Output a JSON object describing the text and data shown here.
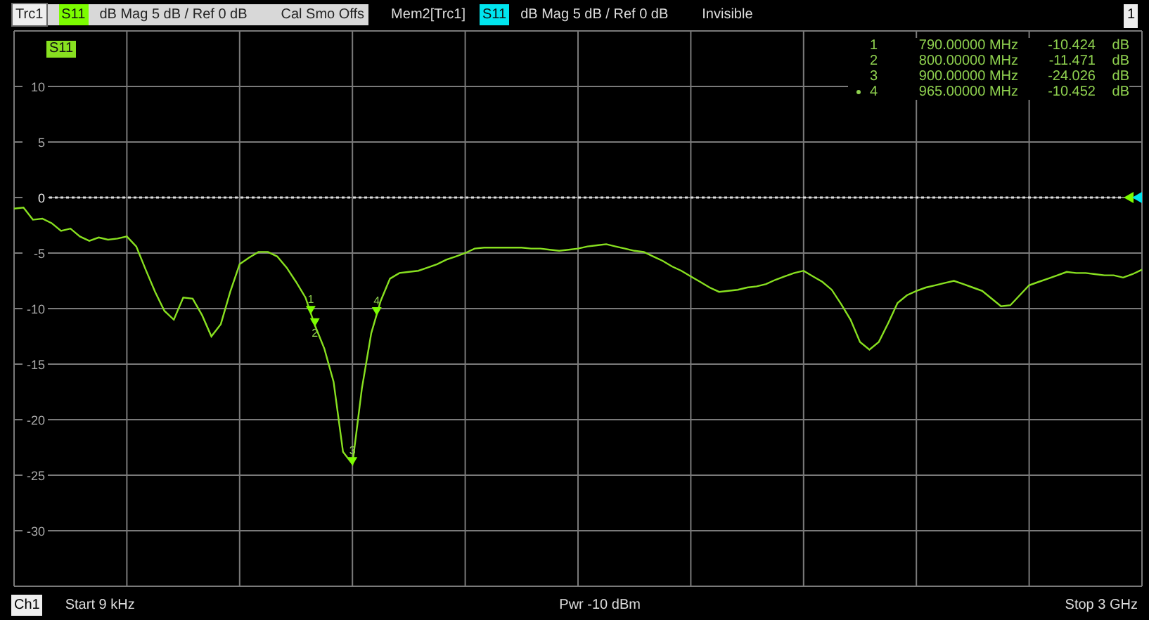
{
  "header": {
    "traces": [
      {
        "name": "Trc1",
        "parameter": "S11",
        "color": "#7cfc00",
        "format": "dB Mag 5 dB / Ref 0 dB",
        "flags": "Cal Smo Offs",
        "highlighted": true
      },
      {
        "name": "Mem2[Trc1]",
        "parameter": "S11",
        "color": "#00e5ee",
        "format": "dB Mag 5 dB / Ref 0 dB",
        "flags": "Invisible",
        "highlighted": false
      }
    ],
    "window_number": "1"
  },
  "diagram": {
    "marker_table": [
      {
        "number": "1",
        "frequency": "790.00000 MHz",
        "value": "-10.424",
        "unit": "dB",
        "active": false
      },
      {
        "number": "2",
        "frequency": "800.00000 MHz",
        "value": "-11.471",
        "unit": "dB",
        "active": false
      },
      {
        "number": "3",
        "frequency": "900.00000 MHz",
        "value": "-24.026",
        "unit": "dB",
        "active": false
      },
      {
        "number": "4",
        "frequency": "965.00000 MHz",
        "value": "-10.452",
        "unit": "dB",
        "active": true
      }
    ],
    "chart_data": {
      "type": "line",
      "grid": true,
      "ref_lines": [
        {
          "axis": "y",
          "value": 0
        }
      ],
      "ylim": [
        -35,
        15
      ],
      "yticks": [
        10,
        5,
        0,
        -5,
        -10,
        -15,
        -20,
        -25,
        -30
      ],
      "categories": [
        null,
        null,
        null,
        null,
        null,
        null,
        null,
        null,
        null,
        null,
        null,
        null,
        null,
        null,
        null,
        null,
        null,
        null,
        null,
        null,
        null,
        null,
        null,
        null,
        null,
        null,
        null,
        null,
        null,
        null,
        null,
        null,
        null,
        null,
        null,
        null,
        null,
        null,
        null,
        null,
        null,
        null,
        null,
        null,
        null,
        null,
        null,
        null,
        null,
        null,
        null,
        null,
        null,
        null,
        null,
        null,
        null,
        null,
        null,
        null,
        null,
        null,
        null,
        null,
        null,
        null,
        null,
        null,
        null,
        null,
        null,
        null,
        null,
        null,
        null,
        null,
        null,
        null,
        null,
        null,
        null,
        null,
        null,
        null,
        null,
        null,
        null,
        null,
        null,
        null,
        null,
        null,
        null,
        null,
        null,
        null,
        null,
        null,
        null,
        null,
        null,
        null,
        null,
        null,
        null,
        null,
        null,
        null,
        null,
        null,
        null,
        null,
        null,
        null,
        null,
        null,
        null,
        null,
        null,
        null,
        null
      ],
      "series": [
        {
          "name": "S11",
          "color": "#88e020",
          "values": [
            -1,
            -0.9,
            -2,
            -1.9,
            -2.3,
            -3,
            -2.8,
            -3.5,
            -3.9,
            -3.6,
            -3.8,
            -3.7,
            -3.5,
            -4.4,
            -6.5,
            -8.5,
            -10.2,
            -11,
            -9,
            -9.1,
            -10.6,
            -12.5,
            -11.4,
            -8.5,
            -6,
            -5.4,
            -4.9,
            -4.9,
            -5.3,
            -6.3,
            -7.6,
            -9,
            -11.5,
            -13.6,
            -16.6,
            -22.9,
            -24,
            -17.2,
            -12.2,
            -9.3,
            -7.3,
            -6.8,
            -6.7,
            -6.6,
            -6.3,
            -6,
            -5.6,
            -5.3,
            -5,
            -4.6,
            -4.5,
            -4.5,
            -4.5,
            -4.5,
            -4.5,
            -4.6,
            -4.6,
            -4.7,
            -4.8,
            -4.7,
            -4.6,
            -4.4,
            -4.3,
            -4.2,
            -4.4,
            -4.6,
            -4.8,
            -4.9,
            -5.3,
            -5.7,
            -6.2,
            -6.6,
            -7.1,
            -7.6,
            -8.1,
            -8.5,
            -8.4,
            -8.3,
            -8.1,
            -8,
            -7.8,
            -7.4,
            -7.1,
            -6.8,
            -6.6,
            -7.1,
            -7.6,
            -8.3,
            -9.6,
            -11,
            -13,
            -13.7,
            -13,
            -11.3,
            -9.5,
            -8.8,
            -8.4,
            -8.1,
            -7.9,
            -7.7,
            -7.5,
            -7.8,
            -8.1,
            -8.4,
            -9.1,
            -9.8,
            -9.7,
            -8.8,
            -7.9,
            -7.6,
            -7.3,
            -7,
            -6.7,
            -6.8,
            -6.8,
            -6.9,
            -7,
            -7,
            -7.2,
            -6.9,
            -6.5
          ]
        }
      ],
      "annotations": [
        {
          "text": "1",
          "y": -10.4
        },
        {
          "text": "2",
          "y": -11.5
        },
        {
          "text": "3",
          "y": -24
        },
        {
          "text": "4",
          "y": -10.5
        }
      ]
    }
  },
  "footer": {
    "channel": "Ch1",
    "start": "Start 9 kHz",
    "power": "Pwr -10 dBm",
    "stop": "Stop 3 GHz"
  }
}
